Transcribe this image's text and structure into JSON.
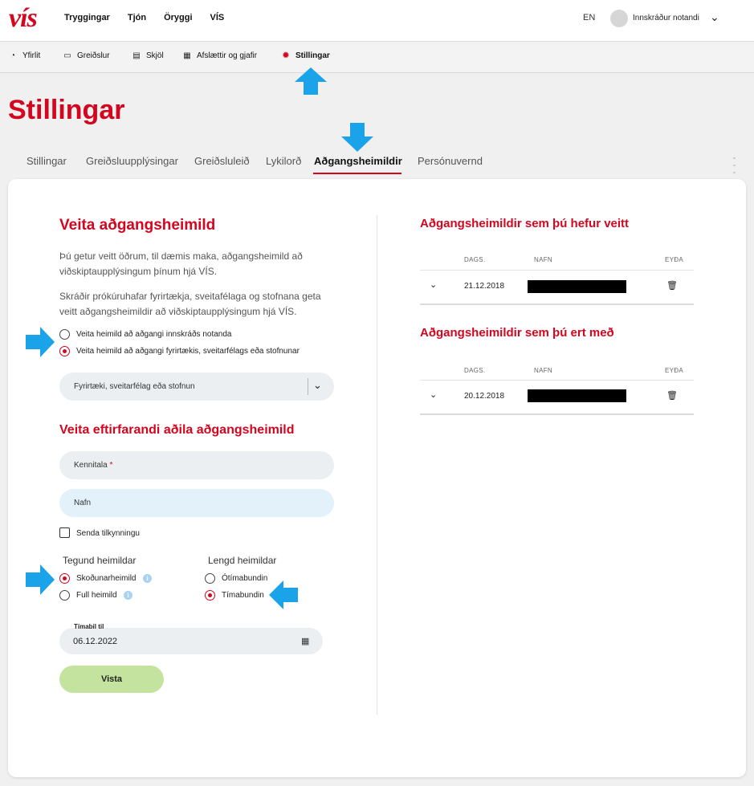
{
  "header": {
    "logo": "vís",
    "nav": [
      "Tryggingar",
      "Tjón",
      "Öryggi",
      "VÍS"
    ],
    "language": "EN",
    "user_name": "Innskráður notandi"
  },
  "subnav": {
    "items": [
      {
        "label": "Yfirlit",
        "icon": "gauge-icon"
      },
      {
        "label": "Greiðslur",
        "icon": "card-icon"
      },
      {
        "label": "Skjöl",
        "icon": "document-icon"
      },
      {
        "label": "Afslættir og gjafir",
        "icon": "gift-icon"
      },
      {
        "label": "Stillingar",
        "icon": "gear-icon"
      }
    ],
    "active": "Stillingar"
  },
  "page_title": "Stillingar",
  "tabs": {
    "items": [
      "Stillingar",
      "Greiðsluupplýsingar",
      "Greiðsluleið",
      "Lykilorð",
      "Aðgangsheimildir",
      "Persónuvernd"
    ],
    "active": "Aðgangsheimildir"
  },
  "grant": {
    "title": "Veita aðgangsheimild",
    "para1_line1": "Þú getur veitt öðrum, til dæmis maka, aðgangsheimild að",
    "para1_line2": "viðskiptaupplýsingum þínum hjá VÍS.",
    "para2_line1": "Skráðir prókúruhafar fyrirtækja, sveitafélaga og stofnana geta",
    "para2_line2": "veitt aðgangsheimildir að viðskiptaupplýsingum hjá VÍS.",
    "option_user": "Veita heimild að aðgangi innskráðs notanda",
    "option_company": "Veita heimild að aðgangi fyrirtækis, sveitarfélags eða stofnunar",
    "selected_option": "company",
    "select_value": "Fyrirtæki, sveitarfélag eða stofnun"
  },
  "recipient": {
    "title": "Veita eftirfarandi aðila aðgangsheimild",
    "kennitala_label": "Kennitala",
    "required_mark": "*",
    "name_label": "Nafn",
    "notify_label": "Senda tilkynningu",
    "notify_checked": false
  },
  "type": {
    "heading": "Tegund heimildar",
    "options": [
      "Skoðunarheimild",
      "Full heimild"
    ],
    "selected": "Skoðunarheimild"
  },
  "duration": {
    "heading": "Lengd heimildar",
    "options": [
      "Ótímabundin",
      "Tímabundin"
    ],
    "selected": "Tímabundin"
  },
  "period": {
    "label": "Tímabil til",
    "value": "06.12.2022"
  },
  "save_label": "Vista",
  "given": {
    "title": "Aðgangsheimildir sem þú hefur veitt",
    "headers": [
      "DAGS.",
      "NAFN",
      "EYÐA"
    ],
    "rows": [
      {
        "date": "21.12.2018",
        "name": "[redacted]"
      }
    ]
  },
  "received": {
    "title": "Aðgangsheimildir sem þú ert með",
    "headers": [
      "DAGS.",
      "NAFN",
      "EYÐA"
    ],
    "rows": [
      {
        "date": "20.12.2018",
        "name": "[redacted]"
      }
    ]
  },
  "colors": {
    "brand_red": "#d4051e",
    "annotation_arrow": "#1aa3e8",
    "save_button": "#c3e39f"
  }
}
